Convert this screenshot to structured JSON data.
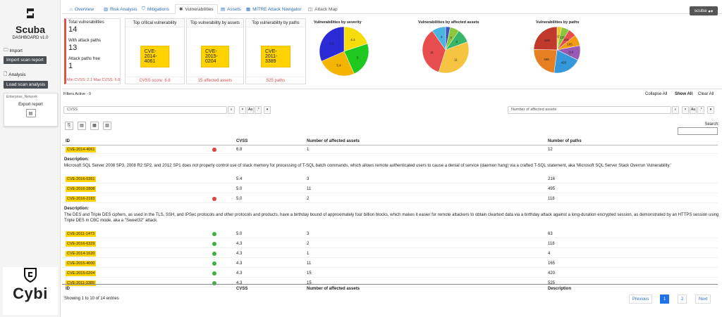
{
  "brand": {
    "name": "Scuba",
    "version": "DASHBOARD v1.0",
    "footer": "Cybi"
  },
  "sidebar": {
    "import_label": "Import",
    "import_button": "Import scan report",
    "analysis_label": "Analysis",
    "load_button": "Load scan analysis",
    "network": "Enterprise_Network",
    "export_label": "Export report"
  },
  "tabs": [
    {
      "label": "Overview"
    },
    {
      "label": "Risk Analysis"
    },
    {
      "label": "Mitigations"
    },
    {
      "label": "Vulnerabilities"
    },
    {
      "label": "Assets"
    },
    {
      "label": "MITRE Attack Navigator"
    },
    {
      "label": "Attack Map"
    }
  ],
  "user": {
    "name": "scuba"
  },
  "stats": {
    "total_label": "Total vulnerabilities",
    "total": "14",
    "paths_label": "With attack paths",
    "paths": "13",
    "free_label": "Attack paths free",
    "free": "1",
    "cvss_range": "Min CVSS: 2.1 Max CVSS: 6.8"
  },
  "cards": [
    {
      "title": "Top critical vulnerability",
      "cve": "CVE-2014-4061",
      "footer": "CVSS score: 6.8"
    },
    {
      "title": "Top vulnerability by assets",
      "cve": "CVE-2015-0204",
      "footer": "15 affected assets"
    },
    {
      "title": "Top vulnerability by paths",
      "cve": "CVE-2011-3389",
      "footer": "525 paths"
    }
  ],
  "pies": {
    "severity_title": "Vulnerabilities by severity",
    "assets_title": "Vulnerabilities by affected assets",
    "paths_title": "Vulnerabilities by paths",
    "severity": [
      {
        "v": 4.3,
        "c": "#f7dc0c"
      },
      {
        "v": 5.0,
        "c": "#1fc81f"
      },
      {
        "v": 5.4,
        "c": "#f5b400"
      },
      {
        "v": 6.8,
        "c": "#2a2ad6"
      }
    ],
    "assets": [
      {
        "v": 1,
        "c": "#3e52c2"
      },
      {
        "v": 2,
        "c": "#8cc63e"
      },
      {
        "v": 3,
        "c": "#37b66a"
      },
      {
        "v": 11,
        "c": "#f5c542"
      },
      {
        "v": 11,
        "c": "#e94e4e"
      },
      {
        "v": 3,
        "c": "#49b4e0"
      }
    ],
    "paths": [
      {
        "v": 4,
        "c": "#3e52c2"
      },
      {
        "v": 63,
        "c": "#f0c420"
      },
      {
        "v": 118,
        "c": "#8cc63e"
      },
      {
        "v": 118,
        "c": "#e94e4e"
      },
      {
        "v": 165,
        "c": "#f39c12"
      },
      {
        "v": 216,
        "c": "#9b59b6"
      },
      {
        "v": 2,
        "c": "#2ecc71"
      },
      {
        "v": 420,
        "c": "#3498db"
      },
      {
        "v": 495,
        "c": "#e67e22"
      },
      {
        "v": 525,
        "c": "#c0392b"
      }
    ]
  },
  "filters": {
    "active": "Filters Active - 0",
    "collapse": "Collapse All",
    "show": "Show All",
    "clear": "Clear All",
    "left_placeholder": "CVSS",
    "right_placeholder": "Number of affected assets"
  },
  "table": {
    "search": "Search:",
    "headers": [
      "ID",
      "CVSS",
      "Number of affected assets",
      "Number of paths"
    ],
    "footer_headers": [
      "ID",
      "CVSS",
      "Number of affected assets",
      "Description"
    ],
    "description_label": "Description:",
    "rows": [
      {
        "id": "CVE-2014-4061",
        "dot": "#e04040",
        "cvss": "6.8",
        "assets": "1",
        "paths": "12"
      },
      {
        "desc": "Microsoft SQL Server 2008 SP3, 2008 R2 SP2, and 2012 SP1 does not properly control use of stack memory for processing of T-SQL batch commands, which allows remote authenticated users to cause a denial of service (daemon hang) via a crafted T-SQL statement, aka 'Microsoft SQL Server Stack Overrun Vulnerability.'"
      },
      {
        "id": "CVE-2016-0351",
        "dot": "",
        "cvss": "5.4",
        "assets": "3",
        "paths": "216"
      },
      {
        "id": "CVE-2016-2808",
        "dot": "",
        "cvss": "5.0",
        "assets": "11",
        "paths": "495"
      },
      {
        "id": "CVE-2016-2183",
        "dot": "#e04040",
        "cvss": "5.0",
        "assets": "2",
        "paths": "118"
      },
      {
        "desc": "The DES and Triple DES ciphers, as used in the TLS, SSH, and IPSec protocols and other protocols and products, have a birthday bound of approximately four billion blocks, which makes it easier for remote attackers to obtain cleartext data via a birthday attack against a long-duration encrypted session, as demonstrated by an HTTPS session using Triple DES in CBC mode, aka a \"Sweet32\" attack."
      },
      {
        "id": "CVE-2011-1473",
        "dot": "#3cb043",
        "cvss": "5.0",
        "assets": "3",
        "paths": "63"
      },
      {
        "id": "CVE-2016-6329",
        "dot": "#3cb043",
        "cvss": "4.3",
        "assets": "2",
        "paths": "118"
      },
      {
        "id": "CVE-2014-1620",
        "dot": "#3cb043",
        "cvss": "4.3",
        "assets": "1",
        "paths": "4"
      },
      {
        "id": "CVE-2015-4000",
        "dot": "#3cb043",
        "cvss": "4.3",
        "assets": "11",
        "paths": "165"
      },
      {
        "id": "CVE-2015-0204",
        "dot": "#3cb043",
        "cvss": "4.3",
        "assets": "15",
        "paths": "420"
      },
      {
        "id": "CVE-2011-3389",
        "dot": "#3cb043",
        "cvss": "4.3",
        "assets": "15",
        "paths": "525"
      }
    ]
  },
  "pagination": {
    "showing": "Showing 1 to 10 of 14 entries",
    "prev": "Previous",
    "p1": "1",
    "p2": "2",
    "next": "Next"
  }
}
